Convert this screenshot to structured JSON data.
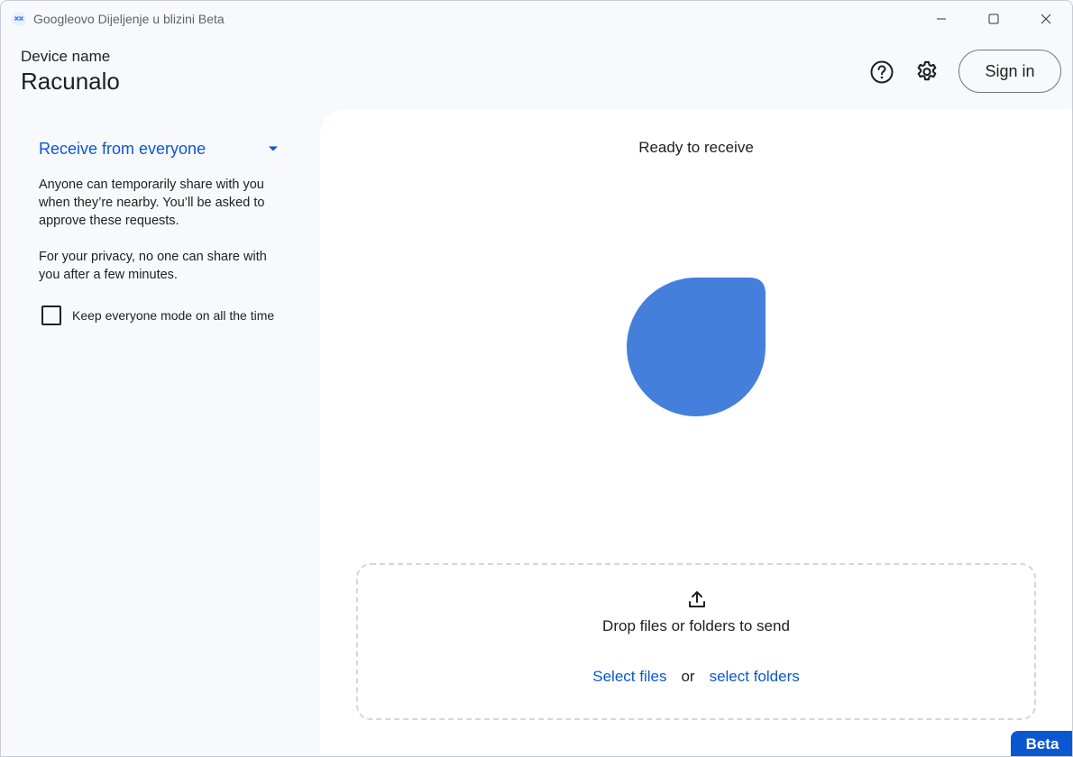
{
  "window": {
    "title": "Googleovo Dijeljenje u blizini Beta"
  },
  "header": {
    "device_label": "Device name",
    "device_name": "Racunalo",
    "help_icon": "help-circle-icon",
    "settings_icon": "gear-icon",
    "signin_label": "Sign in"
  },
  "sidebar": {
    "mode_label": "Receive from everyone",
    "description_1": "Anyone can temporarily share with you when they’re nearby. You’ll be asked to approve these requests.",
    "description_2": "For your privacy, no one can share with you after a few minutes.",
    "checkbox_label": "Keep everyone mode on all the time",
    "checkbox_checked": false
  },
  "main": {
    "status_text": "Ready to receive",
    "drop_text": "Drop files or folders to send",
    "select_files_label": "Select files",
    "or_label": "or",
    "select_folders_label": "select folders"
  },
  "badge": {
    "label": "Beta"
  },
  "colors": {
    "accent": "#0b57d0",
    "blob": "#447fdc",
    "background": "#f8f9fd",
    "panel": "#ffffff"
  }
}
